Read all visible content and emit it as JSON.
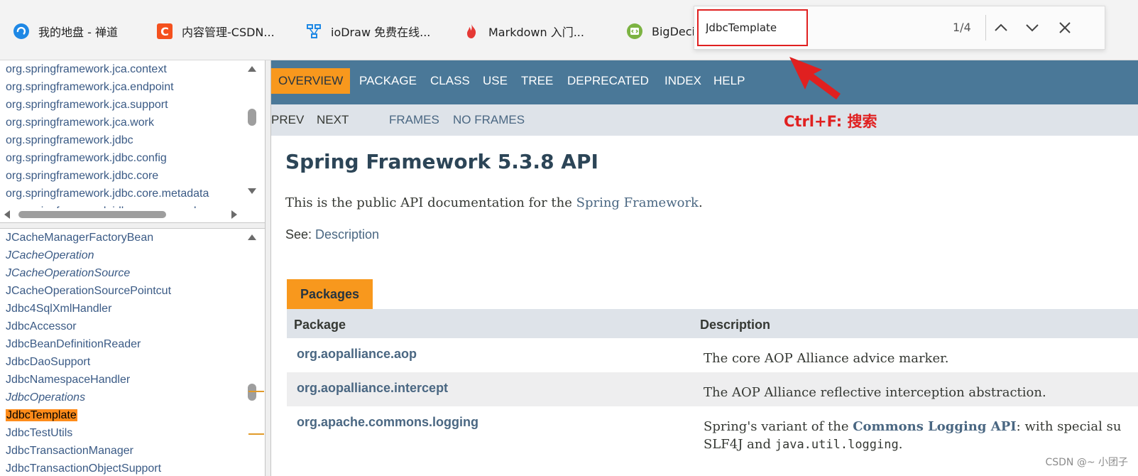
{
  "bookmarks": [
    {
      "label": "我的地盘 - 禅道",
      "icon": "zentao-icon",
      "color": "#1e88e5"
    },
    {
      "label": "内容管理-CSDN...",
      "icon": "csdn-icon",
      "color": "#f4511e"
    },
    {
      "label": "ioDraw 免费在线...",
      "icon": "iodraw-icon",
      "color": "#1e88e5"
    },
    {
      "label": "Markdown 入门...",
      "icon": "flame-icon",
      "color": "#e53935"
    },
    {
      "label": "BigDeci",
      "icon": "code-icon",
      "color": "#7cb342"
    }
  ],
  "find": {
    "value": "JdbcTemplate",
    "count": "1/4"
  },
  "package_list": [
    "org.springframework.jca.context",
    "org.springframework.jca.endpoint",
    "org.springframework.jca.support",
    "org.springframework.jca.work",
    "org.springframework.jdbc",
    "org.springframework.jdbc.config",
    "org.springframework.jdbc.core",
    "org.springframework.jdbc.core.metadata",
    "org.springframework.jdbc.core.namedparar"
  ],
  "class_list": [
    {
      "label": "JCacheManagerFactoryBean",
      "italic": false
    },
    {
      "label": "JCacheOperation",
      "italic": true
    },
    {
      "label": "JCacheOperationSource",
      "italic": true
    },
    {
      "label": "JCacheOperationSourcePointcut",
      "italic": false
    },
    {
      "label": "Jdbc4SqlXmlHandler",
      "italic": false
    },
    {
      "label": "JdbcAccessor",
      "italic": false
    },
    {
      "label": "JdbcBeanDefinitionReader",
      "italic": false
    },
    {
      "label": "JdbcDaoSupport",
      "italic": false
    },
    {
      "label": "JdbcNamespaceHandler",
      "italic": false
    },
    {
      "label": "JdbcOperations",
      "italic": true
    },
    {
      "label": "JdbcTemplate",
      "italic": false,
      "highlight": true
    },
    {
      "label": "JdbcTestUtils",
      "italic": false
    },
    {
      "label": "JdbcTransactionManager",
      "italic": false
    },
    {
      "label": "JdbcTransactionObjectSupport",
      "italic": false
    }
  ],
  "nav": {
    "items": [
      "OVERVIEW",
      "PACKAGE",
      "CLASS",
      "USE",
      "TREE",
      "DEPRECATED",
      "INDEX",
      "HELP"
    ],
    "active": "OVERVIEW"
  },
  "subnav": {
    "prev": "PREV",
    "next": "NEXT",
    "frames": "FRAMES",
    "no_frames": "NO FRAMES"
  },
  "annotation": "Ctrl+F: 搜索",
  "content": {
    "title": "Spring Framework 5.3.8 API",
    "intro_prefix": "This is the public API documentation for the ",
    "intro_link": "Spring Framework",
    "intro_suffix": ".",
    "see_label": "See: ",
    "see_link": "Description"
  },
  "packages": {
    "caption": "Packages",
    "col_package": "Package",
    "col_description": "Description",
    "rows": [
      {
        "name": "org.aopalliance.aop",
        "description": "The core AOP Alliance advice marker."
      },
      {
        "name": "org.aopalliance.intercept",
        "description": "The AOP Alliance reflective interception abstraction."
      },
      {
        "name": "org.apache.commons.logging",
        "desc_prefix": "Spring's variant of the ",
        "desc_link": "Commons Logging API",
        "desc_suffix": ": with special su",
        "desc_line2_prefix": "SLF4J and ",
        "desc_line2_code": "java.util.logging",
        "desc_line2_suffix": "."
      }
    ]
  },
  "watermark": "CSDN @~ 小团子",
  "colors": {
    "nav_bg": "#4a7898",
    "accent_orange": "#f8981d",
    "link": "#4a6782",
    "annotation_red": "#e02020"
  }
}
